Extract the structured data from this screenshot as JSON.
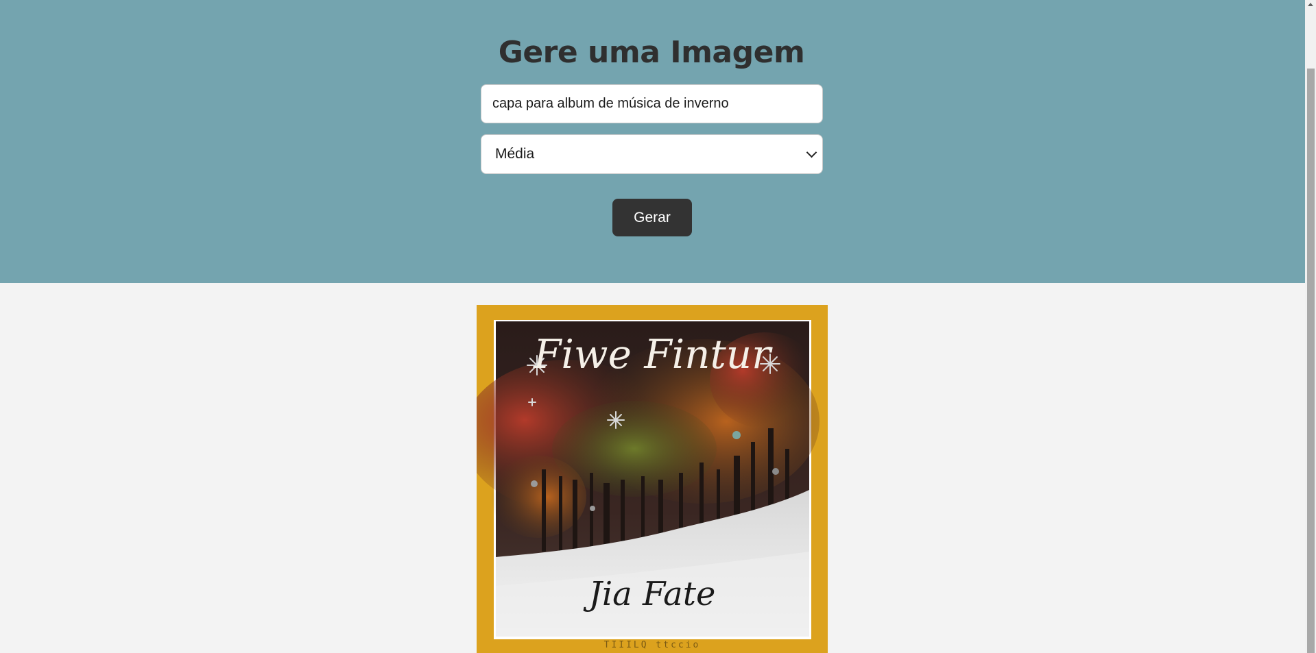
{
  "header": {
    "title": "Gere uma Imagem"
  },
  "form": {
    "prompt_value": "capa para album de música de inverno",
    "size_selected": "Média",
    "generate_label": "Gerar"
  },
  "result": {
    "image_alt": "Generated winter album cover",
    "cover_text_top": "Fiwe Fintur",
    "cover_text_bottom": "Jia Fate",
    "cover_text_small": "TIIILQ ttccio"
  },
  "colors": {
    "hero_bg": "#74a4af",
    "page_bg": "#f3f3f3",
    "button_bg": "#333333",
    "frame": "#dca21e"
  }
}
